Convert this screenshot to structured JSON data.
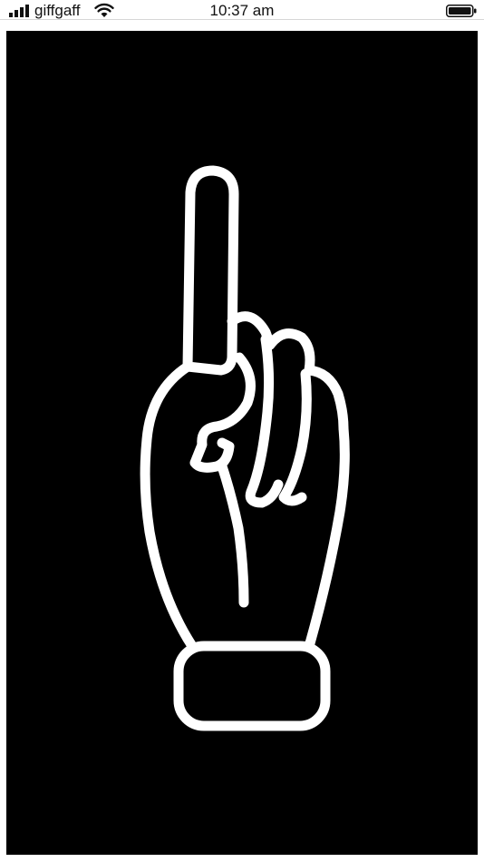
{
  "status_bar": {
    "carrier": "giffgaff",
    "time": "10:37 am",
    "icons": [
      "signal-icon",
      "wifi-icon",
      "battery-icon"
    ]
  },
  "content": {
    "image": "pointing-hand-icon",
    "background_color": "#000000",
    "stroke_color": "#ffffff"
  }
}
